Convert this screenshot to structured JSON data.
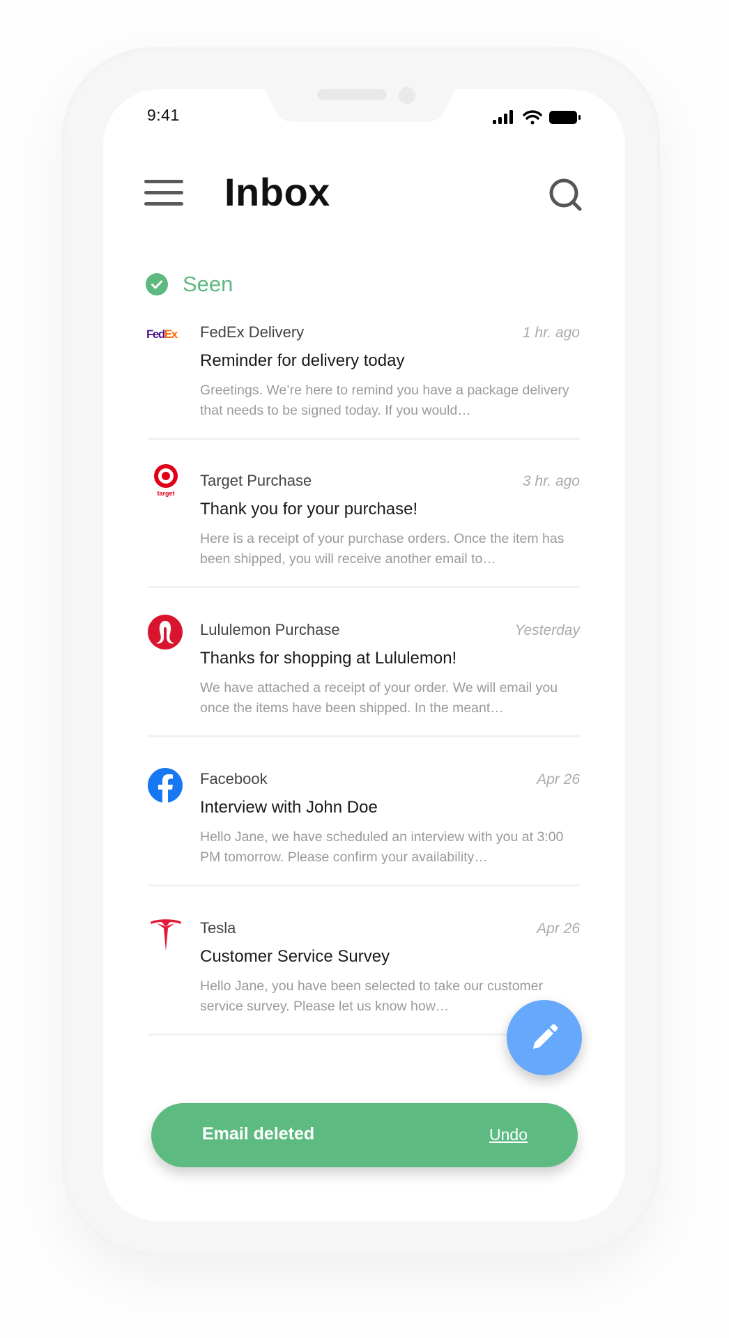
{
  "status_bar": {
    "time": "9:41"
  },
  "header": {
    "title": "Inbox",
    "menu_icon": "hamburger-menu-icon",
    "search_icon": "search-icon"
  },
  "section": {
    "label": "Seen",
    "icon": "check-circle-icon"
  },
  "colors": {
    "accent_green": "#5dba80",
    "fab_blue": "#66a8fb"
  },
  "emails": [
    {
      "sender": "FedEx Delivery",
      "time": "1 hr. ago",
      "subject": "Reminder for delivery today",
      "preview": "Greetings. We’re here to remind you have a package delivery that needs to be signed today. If you would…",
      "logo": "fedex-logo",
      "logo_text": [
        "Fed",
        "Ex"
      ]
    },
    {
      "sender": "Target Purchase",
      "time": "3 hr. ago",
      "subject": "Thank you for your purchase!",
      "preview": "Here is a receipt of your purchase orders. Once the item has been shipped, you will receive another email to…",
      "logo": "target-logo",
      "logo_text": "target"
    },
    {
      "sender": "Lululemon Purchase",
      "time": "Yesterday",
      "subject": "Thanks for shopping at Lululemon!",
      "preview": "We have attached a receipt of your order. We will email you once the items have been shipped. In the meant…",
      "logo": "lululemon-logo"
    },
    {
      "sender": "Facebook",
      "time": "Apr 26",
      "subject": "Interview with John Doe",
      "preview": "Hello Jane, we have scheduled an interview with you at 3:00 PM tomorrow. Please confirm your availability…",
      "logo": "facebook-logo"
    },
    {
      "sender": "Tesla",
      "time": "Apr 26",
      "subject": "Customer Service Survey",
      "preview": "Hello Jane, you have been selected to take our customer service survey. Please let us know how…",
      "logo": "tesla-logo"
    }
  ],
  "fab": {
    "icon": "pencil-icon",
    "label": "Compose"
  },
  "snackbar": {
    "message": "Email deleted",
    "action": "Undo"
  }
}
